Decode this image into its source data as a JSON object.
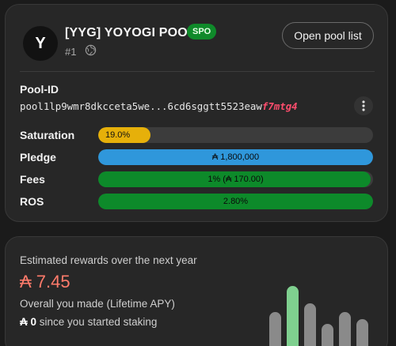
{
  "pool": {
    "avatar_letter": "Y",
    "name": "[YYG] YOYOGI POOL",
    "badge": "SPO",
    "rank": "#1",
    "open_list_label": "Open pool list",
    "pool_id_label": "Pool-ID",
    "pool_id_main": "pool1lp9wmr8dkcceta5we...6cd6sggtt5523eaw",
    "pool_id_suffix": "f7mtg4",
    "icons": {
      "website": "globe-icon",
      "more": "more-vertical-icon"
    }
  },
  "stats": [
    {
      "label": "Saturation",
      "text": "19.0%",
      "fill": 0.19,
      "color": "#e6b00a",
      "align": "left"
    },
    {
      "label": "Pledge",
      "text": "₳ 1,800,000",
      "fill": 1.0,
      "color": "#2f97db",
      "align": "center"
    },
    {
      "label": "Fees",
      "text": "1% (₳ 170.00)",
      "fill": 0.99,
      "color": "#0d8a2a",
      "align": "center"
    },
    {
      "label": "ROS",
      "text": "2.80%",
      "fill": 1.0,
      "color": "#0d8a2a",
      "align": "center"
    }
  ],
  "rewards": {
    "title": "Estimated rewards over the next year",
    "amount": "₳ 7.45",
    "apy_text": "Overall you made (Lifetime APY)",
    "since_amount": "₳ 0",
    "since_text": "since you started staking",
    "decor_bars": [
      {
        "level": 0.55,
        "color": "#8a8a8a"
      },
      {
        "level": 0.85,
        "color": "#7fd08f"
      },
      {
        "level": 0.65,
        "color": "#8a8a8a"
      },
      {
        "level": 0.42,
        "color": "#8a8a8a"
      },
      {
        "level": 0.55,
        "color": "#8a8a8a"
      },
      {
        "level": 0.47,
        "color": "#8a8a8a"
      }
    ]
  },
  "colors": {
    "accent_green": "#0d8a2a",
    "reward_amount": "#ff7b6b",
    "pool_id_suffix": "#ff4d6d"
  }
}
